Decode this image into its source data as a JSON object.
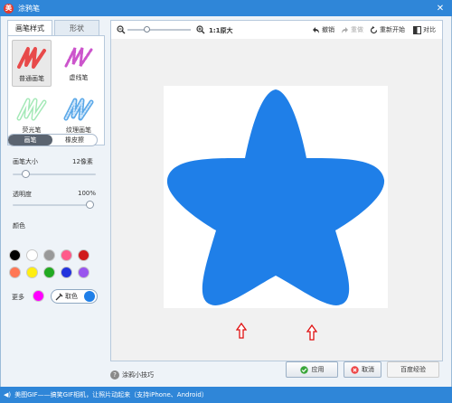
{
  "window": {
    "title": "涂鸦笔",
    "logo_text": "美",
    "close_glyph": "✕"
  },
  "tabs": [
    {
      "label": "画笔样式"
    },
    {
      "label": "形状"
    }
  ],
  "brushes": [
    {
      "label": "普通画笔",
      "color": "#e84a4a"
    },
    {
      "label": "虚线笔",
      "color": "#cc55cc"
    },
    {
      "label": "荧光笔",
      "color": "#8fe3a6"
    },
    {
      "label": "纹理画笔",
      "color": "#5aa8e8"
    }
  ],
  "mode": {
    "pen": "画笔",
    "eraser": "橡皮擦"
  },
  "brush_size": {
    "label": "画笔大小",
    "value": "12像素",
    "level": 0.12
  },
  "opacity": {
    "label": "透明度",
    "value": "100%",
    "level": 1.0
  },
  "colors": {
    "label": "颜色",
    "palette": [
      "#000000",
      "#ffffff",
      "#999999",
      "#ff5a8a",
      "#d01b1b",
      "#ff7755",
      "#ffee11",
      "#22aa22",
      "#2233dd",
      "#9955ee"
    ],
    "more_label": "更多",
    "more_color": "#ff00ff",
    "pick_label": "取色",
    "current": "#1f7fe8"
  },
  "toolbar": {
    "zoom_out_icon": "zoom-out-icon",
    "zoom_in_icon": "zoom-in-icon",
    "actual_size": "1:1原大",
    "undo": "撤销",
    "redo": "重做",
    "restart": "重新开始",
    "compare": "对比"
  },
  "canvas": {
    "star_color": "#1f7fe8"
  },
  "tips": {
    "label": "涂鸦小技巧"
  },
  "buttons": {
    "apply": "应用",
    "cancel": "取消",
    "watermark": "百度经验"
  },
  "status": {
    "text": "美图GIF——搞笑GIF相机，让照片动起来（支持iPhone、Android）"
  }
}
